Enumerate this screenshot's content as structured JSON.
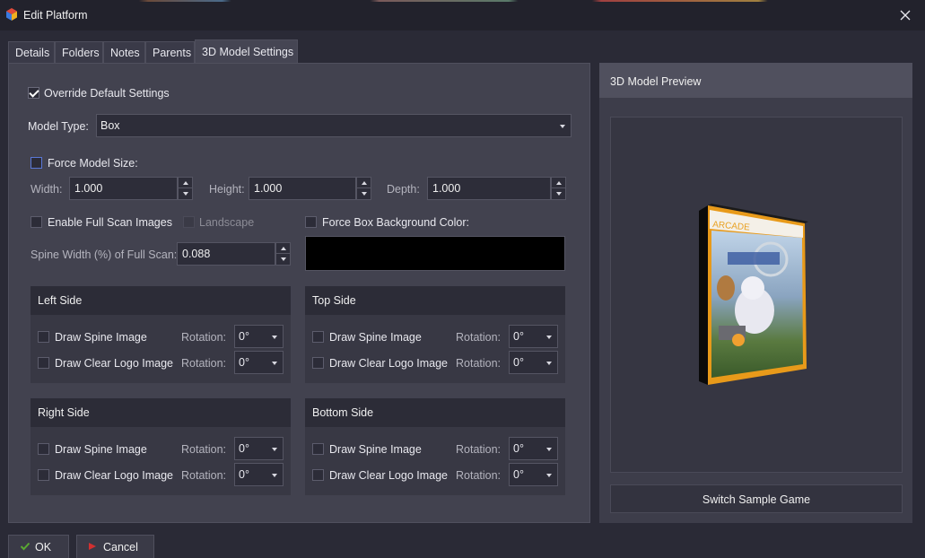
{
  "window": {
    "title": "Edit Platform",
    "close_glyph": "✕"
  },
  "tabs": [
    {
      "label": "Details"
    },
    {
      "label": "Folders"
    },
    {
      "label": "Notes"
    },
    {
      "label": "Parents"
    },
    {
      "label": "3D Model Settings",
      "active": true
    }
  ],
  "settings": {
    "override_label": "Override Default Settings",
    "override_checked": true,
    "model_type_label": "Model Type:",
    "model_type_value": "Box",
    "force_size_label": "Force Model Size:",
    "width_label": "Width:",
    "width_value": "1.000",
    "height_label": "Height:",
    "height_value": "1.000",
    "depth_label": "Depth:",
    "depth_value": "1.000",
    "full_scan_label": "Enable Full Scan Images",
    "landscape_label": "Landscape",
    "force_bg_label": "Force Box Background Color:",
    "bg_color": "#000000",
    "spine_width_label": "Spine Width (%) of Full Scan:",
    "spine_width_value": "0.088"
  },
  "sides": {
    "left": {
      "title": "Left Side",
      "spine_label": "Draw Spine Image",
      "logo_label": "Draw Clear Logo Image",
      "rotation_label": "Rotation:",
      "spine_rotation": "0°",
      "logo_rotation": "0°"
    },
    "top": {
      "title": "Top Side",
      "spine_label": "Draw Spine Image",
      "logo_label": "Draw Clear Logo Image",
      "rotation_label": "Rotation:",
      "spine_rotation": "0°",
      "logo_rotation": "0°"
    },
    "right": {
      "title": "Right Side",
      "spine_label": "Draw Spine Image",
      "logo_label": "Draw Clear Logo Image",
      "rotation_label": "Rotation:",
      "spine_rotation": "0°",
      "logo_rotation": "0°"
    },
    "bottom": {
      "title": "Bottom Side",
      "spine_label": "Draw Spine Image",
      "logo_label": "Draw Clear Logo Image",
      "rotation_label": "Rotation:",
      "spine_rotation": "0°",
      "logo_rotation": "0°"
    }
  },
  "preview": {
    "title": "3D Model Preview",
    "box_banner": "ARCADE",
    "switch_label": "Switch Sample Game"
  },
  "footer": {
    "ok_label": "OK",
    "cancel_label": "Cancel"
  },
  "colors": {
    "accent_check": "#5aa832",
    "cancel_red": "#d23030",
    "box_orange": "#f0a020"
  }
}
